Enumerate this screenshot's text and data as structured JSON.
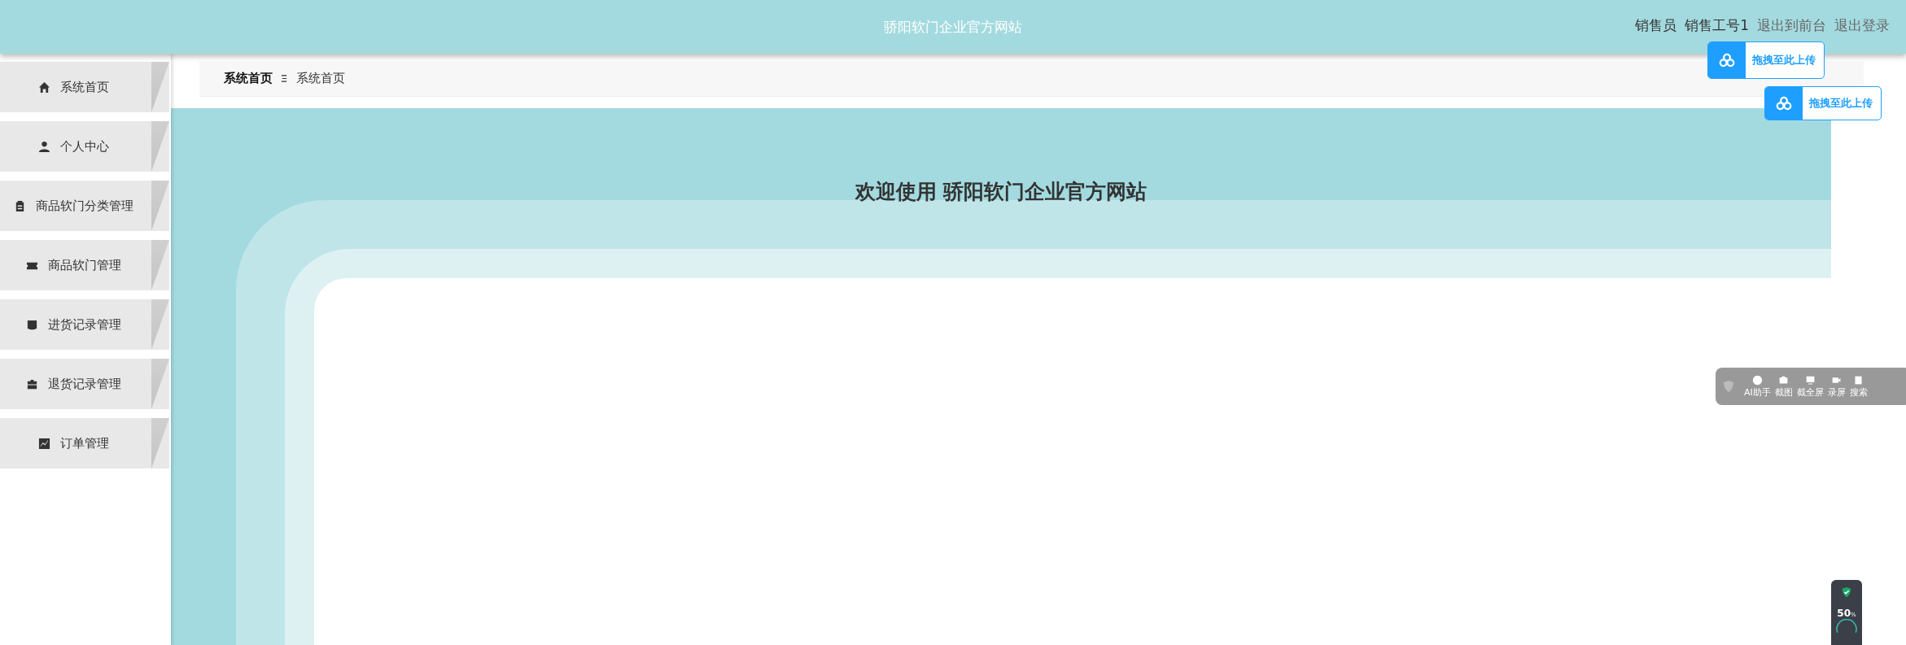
{
  "header": {
    "title": "骄阳软门企业官方网站",
    "user_role": "销售员",
    "user_name": "销售工号1",
    "links": [
      "退出到前台",
      "退出登录"
    ]
  },
  "sidebar": {
    "items": [
      {
        "label": "系统首页"
      },
      {
        "label": "个人中心"
      },
      {
        "label": "商品软门分类管理"
      },
      {
        "label": "商品软门管理"
      },
      {
        "label": "进货记录管理"
      },
      {
        "label": "退货记录管理"
      },
      {
        "label": "订单管理"
      }
    ]
  },
  "breadcrumb": {
    "items": [
      "系统首页",
      "系统首页"
    ]
  },
  "welcome": "欢迎使用 骄阳软门企业官方网站",
  "upload_buttons": [
    "拖拽至此上传",
    "拖拽至此上传"
  ],
  "floating_toolbar": {
    "items": [
      {
        "label": "AI助手"
      },
      {
        "label": "截图"
      },
      {
        "label": "截全屏"
      },
      {
        "label": "录屏"
      },
      {
        "label": "搜索"
      }
    ]
  },
  "status_widget": {
    "value": "50",
    "unit": "%"
  }
}
